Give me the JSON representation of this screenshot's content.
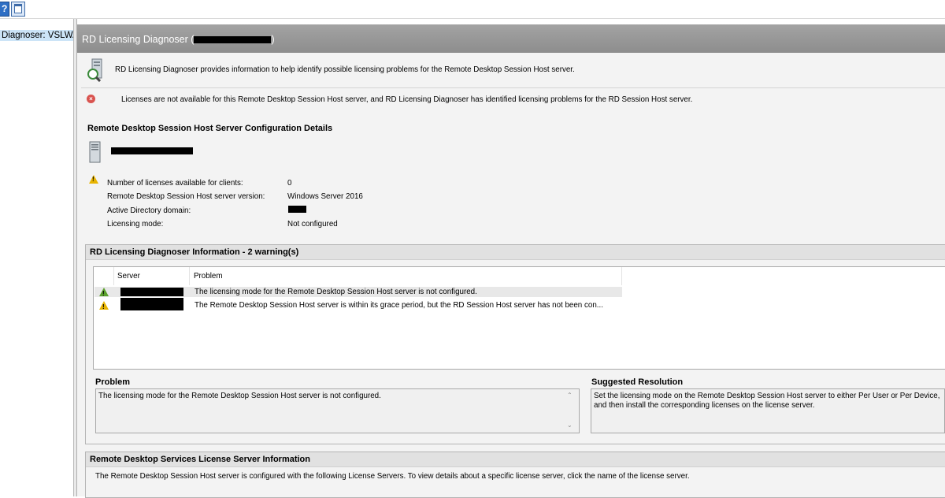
{
  "toolbar": {
    "help_glyph": "?"
  },
  "tree": {
    "item_label": "Diagnoser: VSLWA"
  },
  "header": {
    "title_prefix": "RD Licensing Diagnoser (",
    "title_suffix": ")"
  },
  "intro": {
    "text": "RD Licensing Diagnoser provides information to help identify possible licensing problems for the Remote Desktop Session Host server."
  },
  "error": {
    "text": "Licenses are not available for this Remote Desktop Session Host server, and RD Licensing Diagnoser has identified licensing problems for the RD Session Host server."
  },
  "config": {
    "title": "Remote Desktop Session Host Server Configuration Details",
    "rows": [
      {
        "label": "Number of licenses available for clients:",
        "value": "0"
      },
      {
        "label": "Remote Desktop Session Host server version:",
        "value": "Windows Server 2016"
      },
      {
        "label": "Active Directory domain:",
        "value": ""
      },
      {
        "label": "Licensing mode:",
        "value": "Not configured"
      }
    ]
  },
  "diag": {
    "header": "RD Licensing Diagnoser Information - 2 warning(s)",
    "columns": {
      "server": "Server",
      "problem": "Problem"
    },
    "rows": [
      {
        "problem": "The licensing mode for the Remote Desktop Session Host server is not configured."
      },
      {
        "problem": "The Remote Desktop Session Host server is within its grace period, but the RD Session Host server has not been con..."
      }
    ],
    "problem_label": "Problem",
    "problem_text": "The licensing mode for the Remote Desktop Session Host server is not configured.",
    "resolution_label": "Suggested Resolution",
    "resolution_text": "Set the licensing mode on the Remote Desktop Session Host server to either Per User or Per Device, and then install the corresponding licenses on the license server."
  },
  "license_server": {
    "header": "Remote Desktop Services License Server Information",
    "text": "The Remote Desktop Session Host server is configured with the following License Servers. To view details about a specific license server, click the name of the license server."
  },
  "colors": {
    "title_bar": "#999999",
    "selection": "#cce4f7",
    "warning": "#e8b400",
    "error": "#d9534f"
  }
}
